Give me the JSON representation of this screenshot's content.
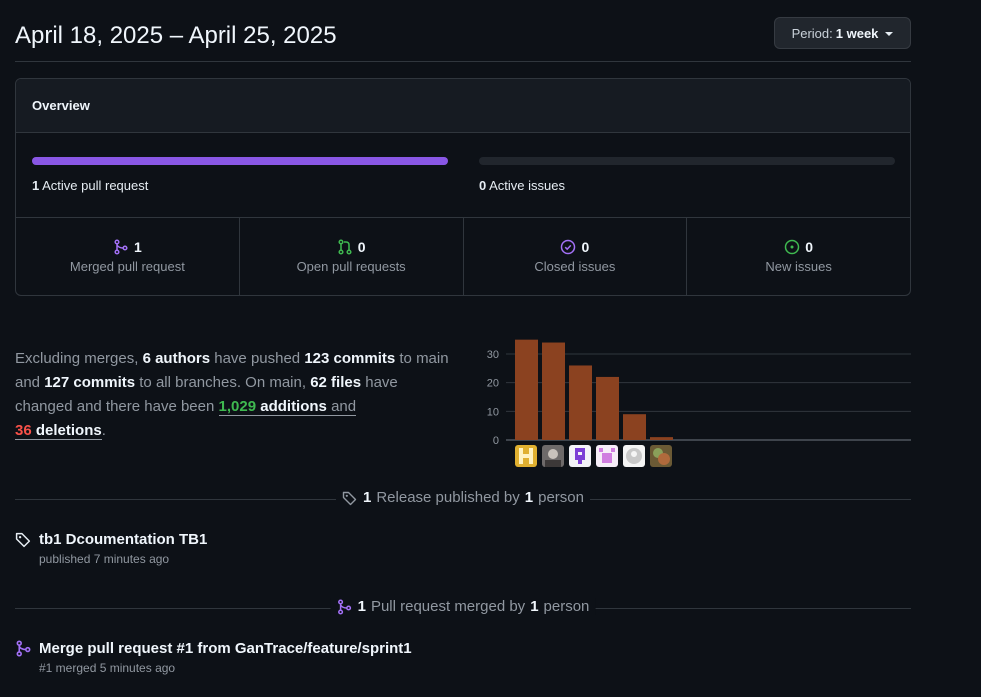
{
  "header": {
    "date_range": "April 18, 2025 – April 25, 2025",
    "period_prefix": "Period:",
    "period_value": "1 week"
  },
  "overview": {
    "title": "Overview",
    "active_prs": {
      "count": "1",
      "label": "Active pull request",
      "fill_fraction": 1.0
    },
    "active_issues": {
      "count": "0",
      "label": "Active issues",
      "fill_fraction": 0.0
    },
    "stats": [
      {
        "icon": "merged-pr-icon",
        "count": "1",
        "label": "Merged pull request",
        "color": "#a371f7"
      },
      {
        "icon": "open-pr-icon",
        "count": "0",
        "label": "Open pull requests",
        "color": "#3fb950"
      },
      {
        "icon": "closed-issue-icon",
        "count": "0",
        "label": "Closed issues",
        "color": "#a371f7"
      },
      {
        "icon": "new-issue-icon",
        "count": "0",
        "label": "New issues",
        "color": "#3fb950"
      }
    ]
  },
  "summary": {
    "t1": "Excluding merges, ",
    "authors": "6 authors",
    "t2": " have pushed ",
    "commits_main": "123 commits",
    "t3": " to main and ",
    "commits_all": "127 commits",
    "t4": " to all branches. On main, ",
    "files": "62 files",
    "t5": " have changed and there have been ",
    "additions_num": "1,029",
    "additions_word": " additions",
    "t6": " and",
    "deletions_num": "36",
    "deletions_word": " deletions",
    "t7": "."
  },
  "chart_data": {
    "type": "bar",
    "categories": [
      "author-1",
      "author-2",
      "author-3",
      "author-4",
      "author-5",
      "author-6"
    ],
    "values": [
      35,
      34,
      26,
      22,
      9,
      1
    ],
    "yticks": [
      "0",
      "10",
      "20",
      "30"
    ],
    "ylim": [
      0,
      35
    ],
    "bar_color": "#8b4220",
    "grid": true
  },
  "releases": {
    "divider_count": "1",
    "divider_mid": "Release published by",
    "divider_people": "1",
    "divider_end": "person",
    "item_title": "tb1 Dcoumentation TB1",
    "item_sub": "published 7 minutes ago"
  },
  "pulls": {
    "divider_count": "1",
    "divider_mid": "Pull request merged by",
    "divider_people": "1",
    "divider_end": "person",
    "item_title": "Merge pull request #1 from GanTrace/feature/sprint1",
    "item_sub": "#1 merged 5 minutes ago"
  }
}
